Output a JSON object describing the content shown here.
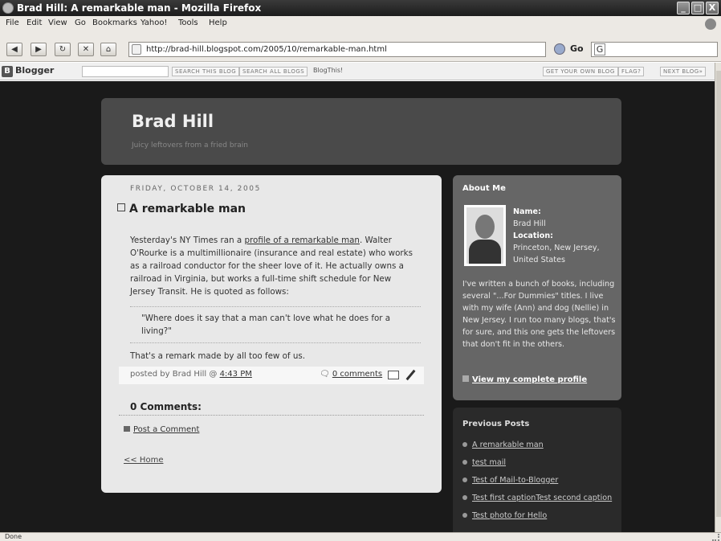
{
  "window": {
    "title": "Brad Hill: A remarkable man - Mozilla Firefox",
    "controls": [
      "_",
      "□",
      "X"
    ]
  },
  "menu": [
    "File",
    "Edit",
    "View",
    "Go",
    "Bookmarks",
    "Yahoo!",
    "Tools",
    "Help"
  ],
  "navigation": {
    "url": "http://brad-hill.blogspot.com/2005/10/remarkable-man.html",
    "go_label": "Go",
    "search_engine_letter": "G"
  },
  "blogger_bar": {
    "logo": "Blogger",
    "search_this_blog": "SEARCH THIS BLOG",
    "search_all_blogs": "SEARCH ALL BLOGS",
    "blogthis": "BlogThis!",
    "get_own_blog": "GET YOUR OWN BLOG",
    "flag": "FLAG?",
    "next_blog": "NEXT BLOG»"
  },
  "blog": {
    "title": "Brad Hill",
    "description": "Juicy leftovers from a fried brain"
  },
  "post": {
    "date": "FRIDAY, OCTOBER 14, 2005",
    "title": "A remarkable man",
    "body_1": "Yesterday's NY Times ran a ",
    "body_link": "profile of a remarkable man",
    "body_2": ". Walter O'Rourke is a multimillionaire (insurance and real estate) who works as a railroad conductor for the sheer love of it. He actually owns a railroad in Virginia, but works a full-time shift schedule for New Jersey Transit. He is quoted as follows:",
    "quote": "\"Where does it say that a man can't love what he does for a living?\"",
    "remark": "That's a remark made by all too few of us.",
    "posted_by": "posted by Brad Hill @ ",
    "time": "4:43 PM",
    "comments_link": "0 comments"
  },
  "comments": {
    "heading": "0 Comments:",
    "post_comment": "Post a Comment",
    "home": "<< Home"
  },
  "about": {
    "heading": "About Me",
    "name_label": "Name:",
    "name": "Brad Hill",
    "location_label": "Location:",
    "location": "Princeton, New Jersey, United States",
    "bio": "I've written a bunch of books, including several \"...For Dummies\" titles. I live with my wife (Ann) and dog (Nellie) in New Jersey. I run too many blogs, that's for sure, and this one gets the leftovers that don't fit in the others.",
    "view_profile": "View my complete profile"
  },
  "previous_posts": {
    "heading": "Previous Posts",
    "items": [
      "A remarkable man",
      "test mail",
      "Test of Mail-to-Blogger",
      "Test first captionTest second caption",
      "Test photo for Hello"
    ]
  },
  "status": "Done",
  "colors": {
    "page_bg": "#1a1a1a",
    "header_bg": "#4a4a4a",
    "post_bg": "#e8e8e8",
    "about_bg": "#666666",
    "prev_bg": "#2a2a2a"
  }
}
